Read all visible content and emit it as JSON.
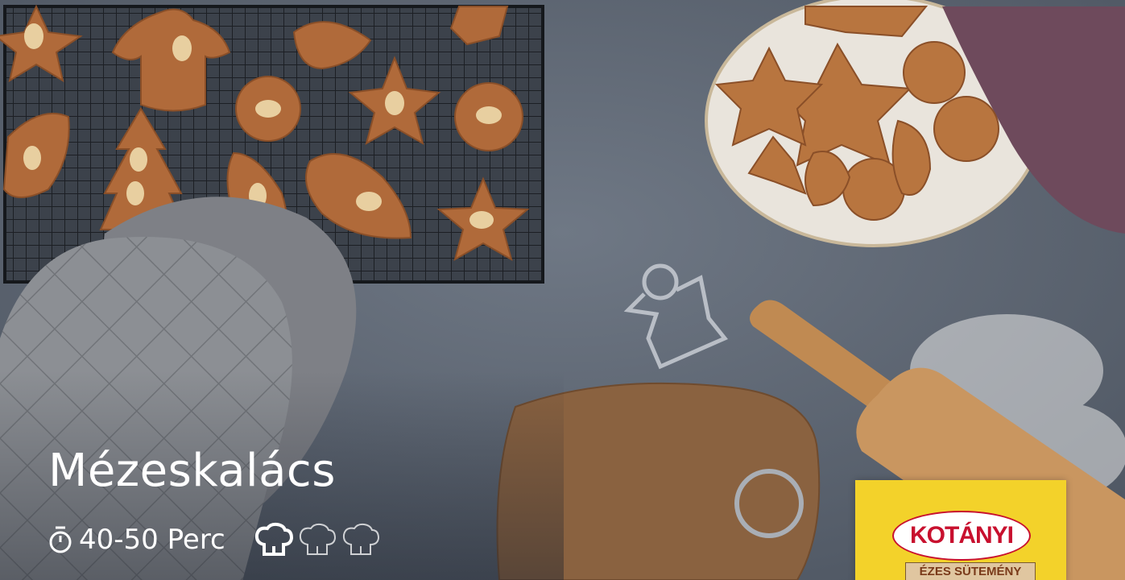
{
  "recipe": {
    "title": "Mézeskalács",
    "time": "40-50 Perc",
    "difficulty": 1,
    "difficulty_max": 3
  },
  "icons": {
    "timer": "timer-icon",
    "difficulty": "chef-hat-icon"
  },
  "product": {
    "brand": "KOTÁNYI",
    "label": "ÉZES SÜTEMÉNY"
  },
  "colors": {
    "text": "#ffffff",
    "brand_red": "#c8102e",
    "package_yellow": "#f3d22a"
  }
}
